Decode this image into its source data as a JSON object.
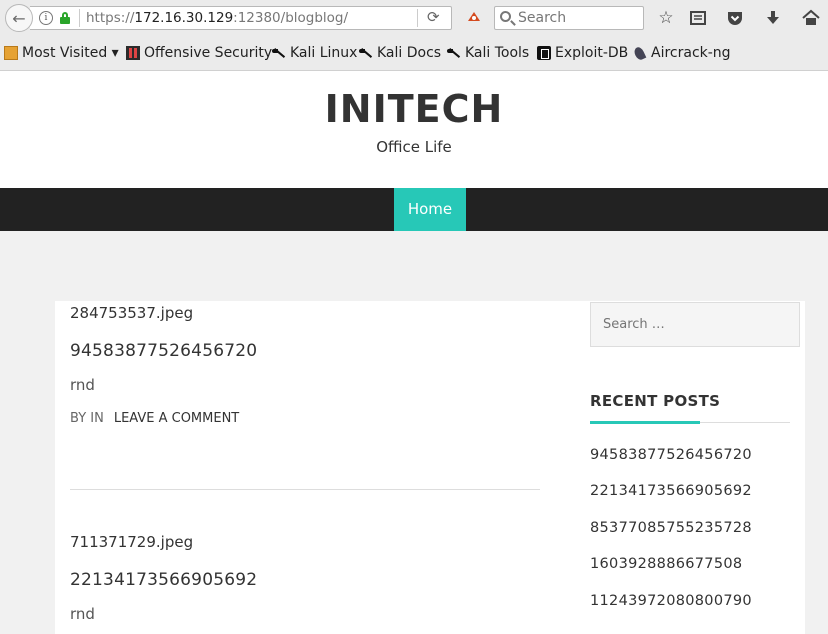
{
  "browser": {
    "url_prefix": "https://",
    "url_host": "172.16.30.129",
    "url_rest": ":12380/blogblog/",
    "search_placeholder": "Search"
  },
  "bookmarks": [
    {
      "label": "Most Visited ▾",
      "icon": "folder-icon"
    },
    {
      "label": "Offensive Security",
      "icon": "offsec-icon"
    },
    {
      "label": "Kali Linux",
      "icon": "kali-icon"
    },
    {
      "label": "Kali Docs",
      "icon": "kali-icon"
    },
    {
      "label": "Kali Tools",
      "icon": "kali-icon"
    },
    {
      "label": "Exploit-DB",
      "icon": "exploitdb-icon"
    },
    {
      "label": "Aircrack-ng",
      "icon": "aircrack-icon"
    }
  ],
  "site": {
    "title": "INITECH",
    "description": "Office Life",
    "nav_home": "Home",
    "accent": "#27c8b7"
  },
  "posts": [
    {
      "file": "284753537.jpeg",
      "title": "94583877526456720",
      "body": "rnd",
      "meta_by": "BY IN",
      "meta_comment": "LEAVE A COMMENT"
    },
    {
      "file": "711371729.jpeg",
      "title": "22134173566905692",
      "body": "rnd"
    }
  ],
  "sidebar": {
    "search_placeholder": "Search …",
    "recent_heading": "RECENT POSTS",
    "recent_posts": [
      "94583877526456720",
      "22134173566905692",
      "85377085755235728",
      "1603928886677508",
      "11243972080800790"
    ]
  }
}
